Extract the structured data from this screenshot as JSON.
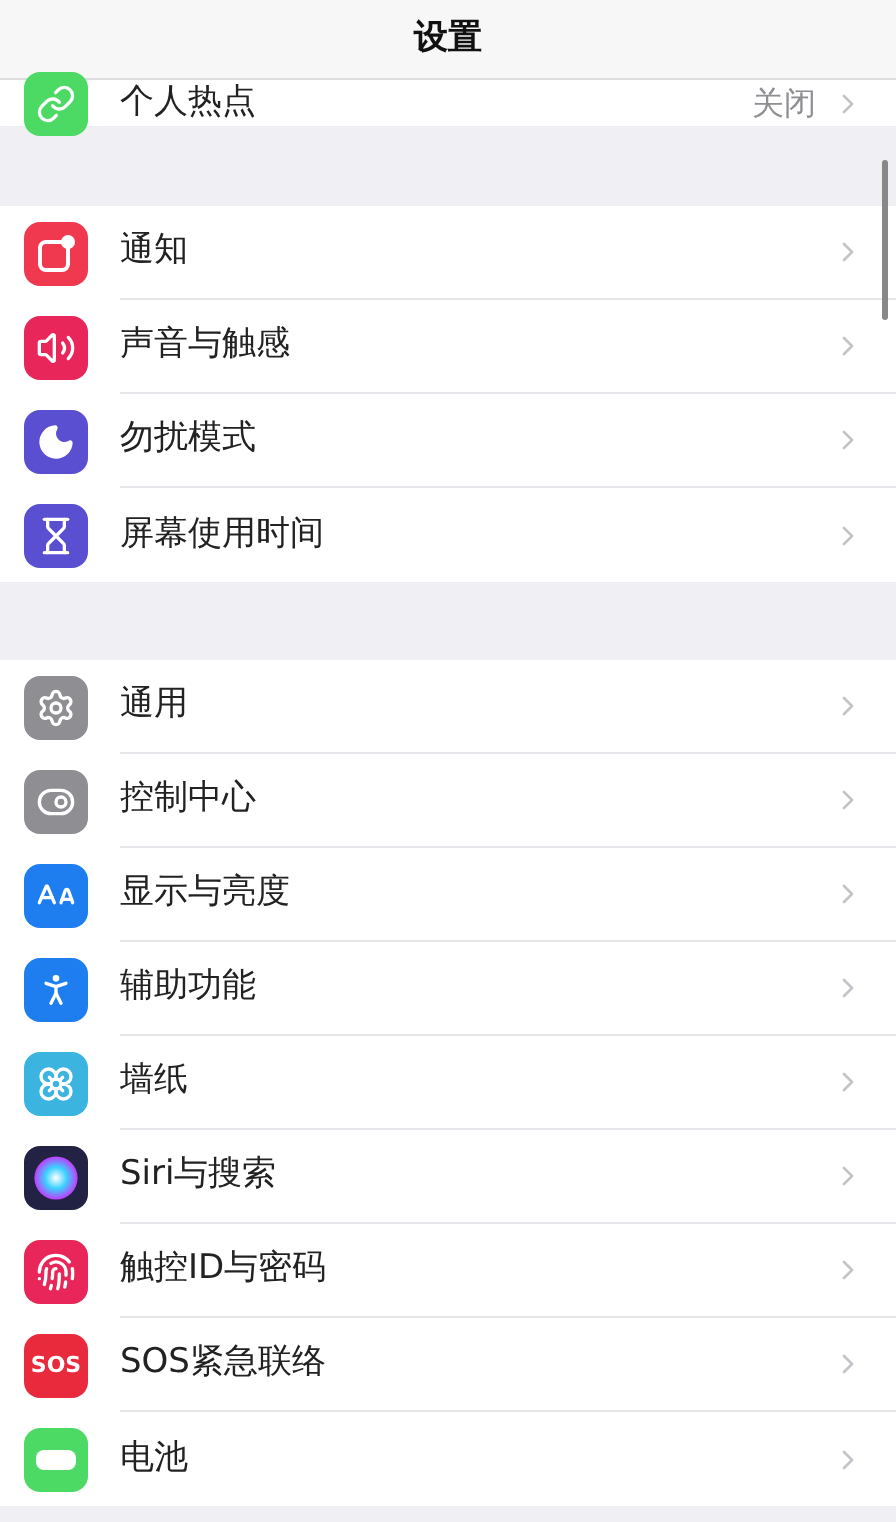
{
  "nav": {
    "title": "设置"
  },
  "groups": [
    {
      "items": [
        {
          "kind": "hotspot",
          "label": "个人热点",
          "value": "关闭"
        }
      ]
    },
    {
      "items": [
        {
          "kind": "notifications",
          "label": "通知"
        },
        {
          "kind": "sounds",
          "label": "声音与触感"
        },
        {
          "kind": "dnd",
          "label": "勿扰模式"
        },
        {
          "kind": "screentime",
          "label": "屏幕使用时间"
        }
      ]
    },
    {
      "items": [
        {
          "kind": "general",
          "label": "通用"
        },
        {
          "kind": "control",
          "label": "控制中心"
        },
        {
          "kind": "display",
          "label": "显示与亮度"
        },
        {
          "kind": "accessibility",
          "label": "辅助功能"
        },
        {
          "kind": "wallpaper",
          "label": "墙纸"
        },
        {
          "kind": "siri",
          "label": "Siri与搜索"
        },
        {
          "kind": "touchid",
          "label": "触控ID与密码"
        },
        {
          "kind": "sos",
          "label": "SOS紧急联络",
          "icon_text": "SOS"
        },
        {
          "kind": "battery",
          "label": "电池"
        }
      ]
    }
  ]
}
